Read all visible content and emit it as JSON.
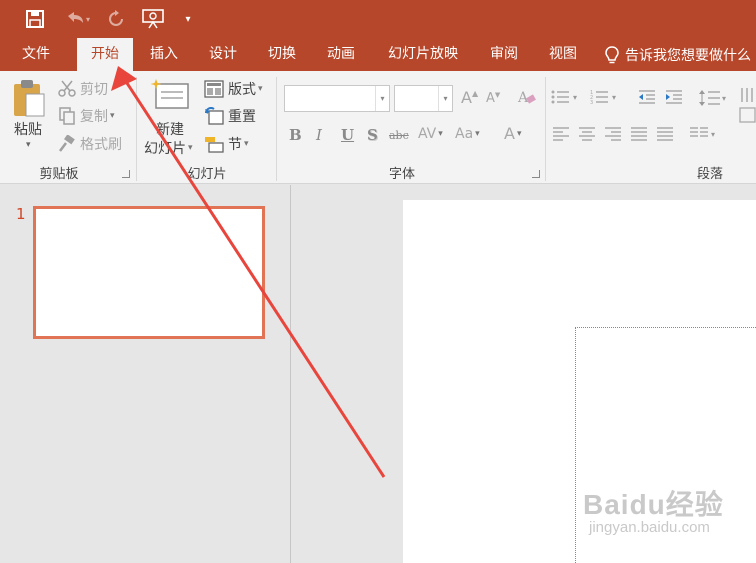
{
  "tabs": [
    {
      "label": "文件"
    },
    {
      "label": "开始"
    },
    {
      "label": "插入"
    },
    {
      "label": "设计"
    },
    {
      "label": "切换"
    },
    {
      "label": "动画"
    },
    {
      "label": "幻灯片放映"
    },
    {
      "label": "审阅"
    },
    {
      "label": "视图"
    }
  ],
  "tell_me": "告诉我您想要做什么",
  "ribbon": {
    "clipboard": {
      "paste": "粘贴",
      "cut": "剪切",
      "copy": "复制",
      "format_painter": "格式刷",
      "group_label": "剪贴板"
    },
    "slides": {
      "new_slide_line1": "新建",
      "new_slide_line2": "幻灯片",
      "layout": "版式",
      "reset": "重置",
      "section": "节",
      "group_label": "幻灯片"
    },
    "font": {
      "grow": "A",
      "shrink": "A",
      "bold": "B",
      "italic": "I",
      "underline": "U",
      "shadow": "S",
      "strikethrough": "abc",
      "spacing": "AV",
      "case": "Aa",
      "color": "A",
      "group_label": "字体"
    },
    "paragraph": {
      "group_label": "段落"
    }
  },
  "thumbnails": [
    {
      "number": "1"
    }
  ],
  "watermark": {
    "main": "Baidu经验",
    "sub": "jingyan.baidu.com"
  },
  "colors": {
    "accent": "#b7472a",
    "active_tab_text": "#b7472a",
    "thumb_border": "#e07455",
    "annotation_arrow": "#e8453c"
  }
}
